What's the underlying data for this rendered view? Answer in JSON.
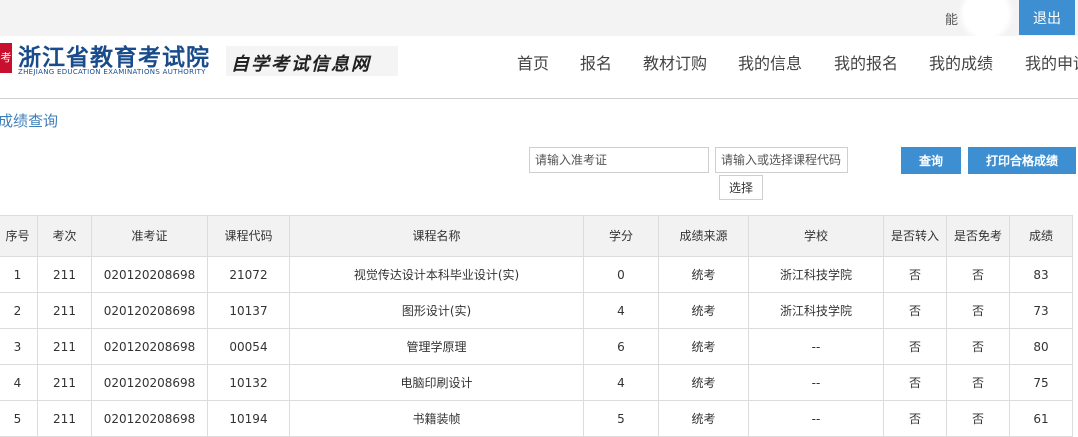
{
  "topbar": {
    "user_text": "能",
    "logout_label": "退出"
  },
  "header": {
    "logo_mark": "考",
    "logo_title": "浙江省教育考试院",
    "logo_en": "ZHEJIANG EDUCATION EXAMINATIONS AUTHORITY",
    "site_name": "自学考试信息网"
  },
  "nav": [
    "首页",
    "报名",
    "教材订购",
    "我的信息",
    "我的报名",
    "我的成绩",
    "我的申请"
  ],
  "page_title": "成绩查询",
  "search": {
    "exam_id_placeholder": "请输入准考证",
    "course_code_placeholder": "请输入或选择课程代码",
    "select_label": "选择",
    "query_label": "查询",
    "print_label": "打印合格成绩"
  },
  "table": {
    "headers": [
      "序号",
      "考次",
      "准考证",
      "课程代码",
      "课程名称",
      "学分",
      "成绩来源",
      "学校",
      "是否转入",
      "是否免考",
      "成绩"
    ],
    "rows": [
      [
        "1",
        "211",
        "020120208698",
        "21072",
        "视觉传达设计本科毕业设计(实)",
        "0",
        "统考",
        "浙江科技学院",
        "否",
        "否",
        "83"
      ],
      [
        "2",
        "211",
        "020120208698",
        "10137",
        "图形设计(实)",
        "4",
        "统考",
        "浙江科技学院",
        "否",
        "否",
        "73"
      ],
      [
        "3",
        "211",
        "020120208698",
        "00054",
        "管理学原理",
        "6",
        "统考",
        "--",
        "否",
        "否",
        "80"
      ],
      [
        "4",
        "211",
        "020120208698",
        "10132",
        "电脑印刷设计",
        "4",
        "统考",
        "--",
        "否",
        "否",
        "75"
      ],
      [
        "5",
        "211",
        "020120208698",
        "10194",
        "书籍装帧",
        "5",
        "统考",
        "--",
        "否",
        "否",
        "61"
      ]
    ]
  }
}
